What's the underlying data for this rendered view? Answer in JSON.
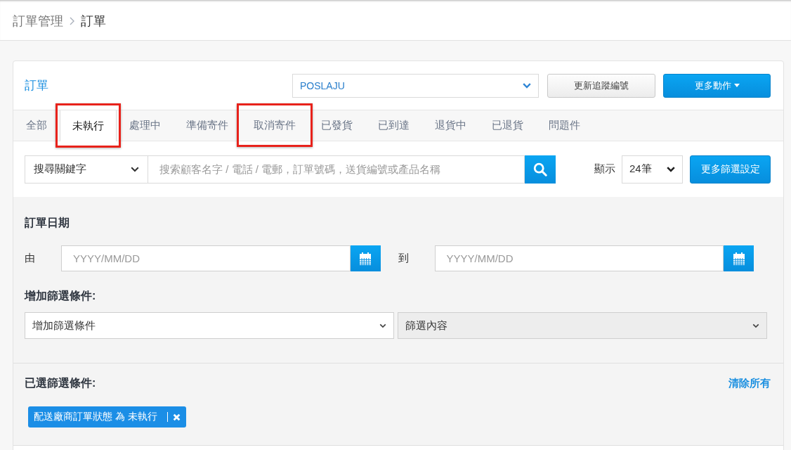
{
  "breadcrumb": [
    {
      "label": "訂單管理",
      "current": false
    },
    {
      "label": "訂單",
      "current": true
    }
  ],
  "card": {
    "title": "訂單",
    "courier_select": {
      "value": "POSLAJU"
    },
    "buttons": [
      {
        "label": "更新追蹤編號",
        "kind": "secondary",
        "caret": false
      },
      {
        "label": "更多動作",
        "kind": "primary",
        "caret": true
      }
    ]
  },
  "tabs": [
    {
      "label": "全部",
      "selected": false,
      "highlighted": false
    },
    {
      "label": "未執行",
      "selected": true,
      "highlighted": true
    },
    {
      "label": "處理中",
      "selected": false,
      "highlighted": false
    },
    {
      "label": "準備寄件",
      "selected": false,
      "highlighted": false
    },
    {
      "label": "取消寄件",
      "selected": false,
      "highlighted": true
    },
    {
      "label": "已發貨",
      "selected": false,
      "highlighted": false
    },
    {
      "label": "已到達",
      "selected": false,
      "highlighted": false
    },
    {
      "label": "退貨中",
      "selected": false,
      "highlighted": false
    },
    {
      "label": "已退貨",
      "selected": false,
      "highlighted": false
    },
    {
      "label": "問題件",
      "selected": false,
      "highlighted": false
    }
  ],
  "search": {
    "field_select": "搜尋關鍵字",
    "placeholder": "搜索顧客名字 / 電話 / 電郵，訂單號碼，送貨編號或產品名稱",
    "show_label": "顯示",
    "page_size": "24筆",
    "more_filters_button": "更多篩選設定"
  },
  "order_date": {
    "heading": "訂單日期",
    "fields": [
      {
        "label": "由",
        "placeholder": "YYYY/MM/DD"
      },
      {
        "label": "到",
        "placeholder": "YYYY/MM/DD"
      }
    ]
  },
  "add_filter": {
    "heading": "增加篩選條件:",
    "selects": [
      {
        "value": "增加篩選條件",
        "disabled": false
      },
      {
        "value": "篩選內容",
        "disabled": true
      }
    ]
  },
  "selected_filters": {
    "heading": "已選篩選條件:",
    "clear_all": "清除所有",
    "tags": [
      {
        "label": "配送廠商訂單狀態 為 未執行"
      }
    ]
  }
}
